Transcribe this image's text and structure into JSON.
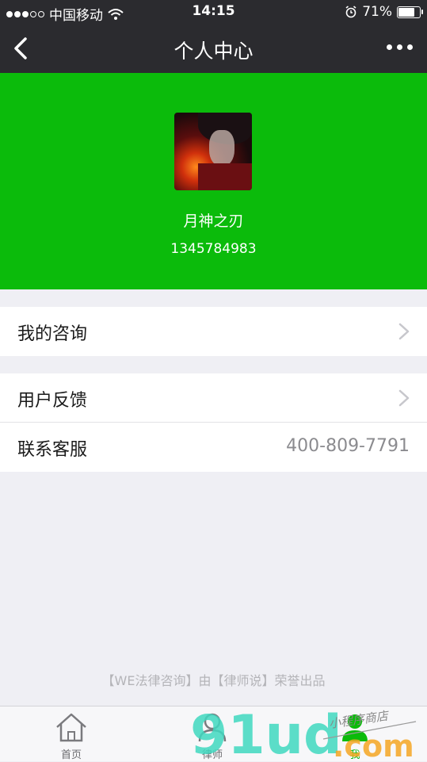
{
  "status_bar": {
    "carrier": "中国移动",
    "time": "14:15",
    "battery": "71%",
    "battery_level": 0.71,
    "icons": [
      "signal-dots-icon",
      "wifi-icon",
      "alarm-icon",
      "battery-icon"
    ]
  },
  "nav": {
    "title": "个人中心",
    "back_icon": "back-chevron-icon",
    "more_icon": "more-dots-icon"
  },
  "profile": {
    "name": "月神之刃",
    "phone": "1345784983",
    "background_color": "#0bbb0b"
  },
  "menu": {
    "group1": [
      {
        "label": "我的咨询",
        "icon": "chevron-right-icon"
      }
    ],
    "group2": [
      {
        "label": "用户反馈",
        "icon": "chevron-right-icon"
      },
      {
        "label": "联系客服",
        "value": "400-809-7791"
      }
    ]
  },
  "footer": {
    "text": "【WE法律咨询】由【律师说】荣誉出品"
  },
  "tabs": [
    {
      "label": "首页",
      "icon": "home-icon",
      "active": false
    },
    {
      "label": "律师",
      "icon": "person-icon",
      "active": false
    },
    {
      "label": "我",
      "icon": "person-icon",
      "active": true
    }
  ],
  "watermark": {
    "brand": "91ud",
    "suffix": ".com",
    "subtitle": "小程序商店"
  }
}
